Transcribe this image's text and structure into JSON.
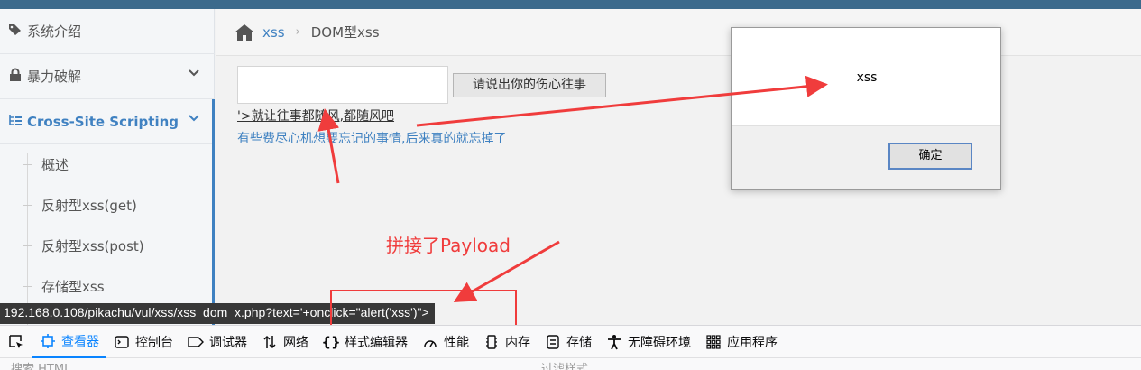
{
  "sidebar": {
    "items": [
      {
        "label": "系统介绍",
        "icon": "tags-icon"
      },
      {
        "label": "暴力破解",
        "icon": "lock-icon"
      },
      {
        "label": "Cross-Site Scripting",
        "icon": "list-tree-icon"
      }
    ],
    "subitems": [
      "概述",
      "反射型xss(get)",
      "反射型xss(post)",
      "存储型xss"
    ]
  },
  "breadcrumb": {
    "home_icon": "home-icon",
    "link": "xss",
    "separator": "›",
    "current": "DOM型xss"
  },
  "main": {
    "input_value": "",
    "submit_label": "请说出你的伤心往事",
    "dom_link": "'>就让往事都随风,都随风吧",
    "hint": "有些费尽心机想要忘记的事情,后来真的就忘掉了"
  },
  "dialog": {
    "message": "xss",
    "ok_label": "确定"
  },
  "status_url": "192.168.0.108/pikachu/vul/xss/xss_dom_x.php?text='+onclick=\"alert('xss')\">",
  "annotation": {
    "text": "拼接了Payload",
    "color": "#f03c3c"
  },
  "devtools": {
    "tabs": [
      {
        "label": "查看器",
        "icon": "inspector-icon",
        "selected": true
      },
      {
        "label": "控制台",
        "icon": "console-icon"
      },
      {
        "label": "调试器",
        "icon": "debugger-icon"
      },
      {
        "label": "网络",
        "icon": "network-icon"
      },
      {
        "label": "样式编辑器",
        "icon": "style-editor-icon"
      },
      {
        "label": "性能",
        "icon": "performance-icon"
      },
      {
        "label": "内存",
        "icon": "memory-icon"
      },
      {
        "label": "存储",
        "icon": "storage-icon"
      },
      {
        "label": "无障碍环境",
        "icon": "accessibility-icon"
      },
      {
        "label": "应用程序",
        "icon": "application-icon"
      }
    ],
    "search_html_placeholder": "搜索 HTML",
    "filter_styles_placeholder": "过滤样式"
  },
  "colors": {
    "accent": "#3f81c1",
    "annotation": "#f03c3c",
    "topbar": "#3c6a8c"
  }
}
